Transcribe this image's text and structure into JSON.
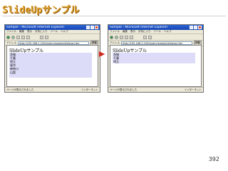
{
  "slide": {
    "title": "SlideUpサンプル",
    "page_number": "392"
  },
  "browser": {
    "window_title": "Sample - Microsoft Internet Explorer",
    "menu": [
      "ファイル",
      "編集",
      "表示",
      "お気に入り",
      "ツール",
      "ヘルプ"
    ],
    "address_label": "アドレス",
    "address_value": "http://192.168.1.100/jquery/sample/slideup.htm",
    "go_label": "移動",
    "status_left": "ページが表示されました",
    "status_zone": "インターネット"
  },
  "before": {
    "heading": "SlideUpサンプル",
    "items": [
      "茨城",
      "千葉",
      "埼玉",
      "東京",
      "神奈川",
      "山梨"
    ]
  },
  "after": {
    "heading": "SlideUpサンプル",
    "items": [
      "茨城",
      "千葉",
      "埼玉"
    ]
  },
  "colors": {
    "title": "#e0a02a",
    "list_bg": "#dddcf8",
    "arrow": "#cc2a1e"
  }
}
